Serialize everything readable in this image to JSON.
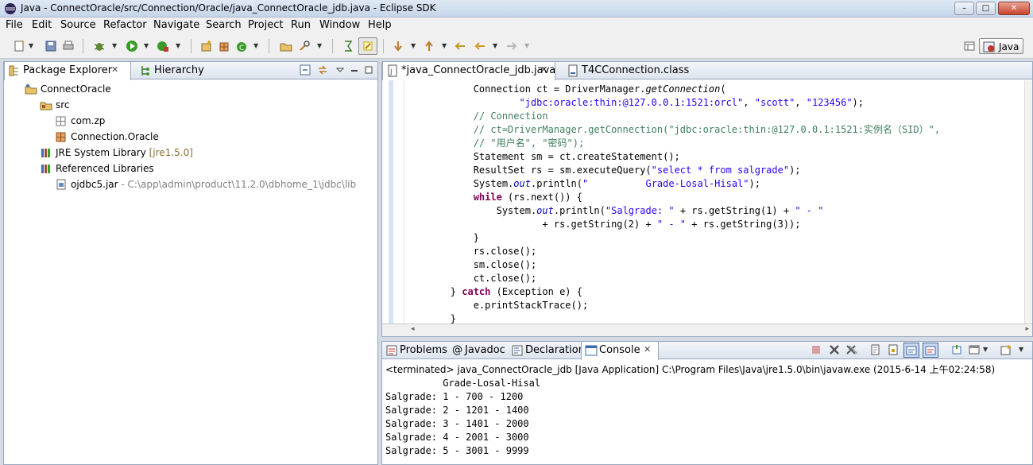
{
  "window": {
    "title": "Java - ConnectOracle/src/Connection/Oracle/java_ConnectOracle_jdb.java - Eclipse SDK",
    "min_glyph": "–",
    "max_glyph": "□",
    "close_glyph": "✕"
  },
  "menu": [
    "File",
    "Edit",
    "Source",
    "Refactor",
    "Navigate",
    "Search",
    "Project",
    "Run",
    "Window",
    "Help"
  ],
  "toolbar": {
    "perspective_label": "Java"
  },
  "package_explorer": {
    "tabs": [
      {
        "label": "Package Explorer",
        "close": "✕"
      },
      {
        "label": "Hierarchy"
      }
    ],
    "tree": [
      {
        "label": "ConnectOracle",
        "suffix": "",
        "decor": "",
        "icon": "java-project-icon"
      },
      {
        "label": "src",
        "suffix": "",
        "decor": "",
        "icon": "source-folder-icon"
      },
      {
        "label": "com.zp",
        "suffix": "",
        "decor": "",
        "icon": "package-empty-icon"
      },
      {
        "label": "Connection.Oracle",
        "suffix": "",
        "decor": "",
        "icon": "package-icon"
      },
      {
        "label": "JRE System Library",
        "suffix": "[jre1.5.0]",
        "decor": "",
        "icon": "library-icon"
      },
      {
        "label": "Referenced Libraries",
        "suffix": "",
        "decor": "",
        "icon": "library-icon"
      },
      {
        "label": "ojdbc5.jar",
        "suffix": "",
        "decor": " - C:\\app\\admin\\product\\11.2.0\\dbhome_1\\jdbc\\lib",
        "icon": "jar-icon"
      }
    ]
  },
  "editor": {
    "tabs": [
      {
        "label": "*java_ConnectOracle_jdb.java",
        "close": "✕"
      },
      {
        "label": "T4CConnection.class"
      }
    ],
    "lines": [
      [
        [
          "",
          "            Connection ct = DriverManager."
        ],
        [
          "sm",
          "getConnection"
        ],
        [
          "",
          "("
        ]
      ],
      [
        [
          "",
          "                    "
        ],
        [
          "str",
          "\"jdbc:oracle:thin:@127.0.0.1:1521:orcl\""
        ],
        [
          "",
          ", "
        ],
        [
          "str",
          "\"scott\""
        ],
        [
          "",
          ", "
        ],
        [
          "str",
          "\"123456\""
        ],
        [
          "",
          ");"
        ]
      ],
      [
        [
          "cm",
          "            // Connection"
        ]
      ],
      [
        [
          "cm",
          "            // ct=DriverManager.getConnection(\"jdbc:oracle:thin:@127.0.0.1:1521:实例名（SID）\","
        ]
      ],
      [
        [
          "cm",
          "            // \"用户名\", \"密码\");"
        ]
      ],
      [
        [
          "",
          "            Statement sm = ct.createStatement();"
        ]
      ],
      [
        [
          "",
          "            ResultSet rs = sm.executeQuery("
        ],
        [
          "str",
          "\"select * from salgrade\""
        ],
        [
          "",
          ");"
        ]
      ],
      [
        [
          "",
          "            System."
        ],
        [
          "fld",
          "out"
        ],
        [
          "",
          ".println("
        ],
        [
          "str",
          "\"          Grade-Losal-Hisal\""
        ],
        [
          "",
          ");"
        ]
      ],
      [
        [
          "kw",
          "            while"
        ],
        [
          "",
          " (rs.next()) {"
        ]
      ],
      [
        [
          "",
          "                System."
        ],
        [
          "fld",
          "out"
        ],
        [
          "",
          ".println("
        ],
        [
          "str",
          "\"Salgrade: \""
        ],
        [
          "",
          " + rs.getString(1) + "
        ],
        [
          "str",
          "\" - \""
        ]
      ],
      [
        [
          "",
          "                        + rs.getString(2) + "
        ],
        [
          "str",
          "\" - \""
        ],
        [
          "",
          " + rs.getString(3));"
        ]
      ],
      [
        [
          "",
          "            }"
        ]
      ],
      [
        [
          "",
          "            rs.close();"
        ]
      ],
      [
        [
          "",
          "            sm.close();"
        ]
      ],
      [
        [
          "",
          "            ct.close();"
        ]
      ],
      [
        [
          "",
          "        } "
        ],
        [
          "kw",
          "catch"
        ],
        [
          "",
          " (Exception e) {"
        ]
      ],
      [
        [
          "",
          "            e.printStackTrace();"
        ]
      ],
      [
        [
          "",
          "        }"
        ]
      ]
    ]
  },
  "bottom_panel": {
    "tabs": [
      {
        "label": "Problems"
      },
      {
        "label": "Javadoc",
        "prefix": "@"
      },
      {
        "label": "Declaration"
      },
      {
        "label": "Console",
        "close": "✕"
      }
    ],
    "status": "<terminated> java_ConnectOracle_jdb [Java Application] C:\\Program Files\\Java\\jre1.5.0\\bin\\javaw.exe (2015-6-14 上午02:24:58)",
    "output": [
      "          Grade-Losal-Hisal",
      "Salgrade: 1 - 700 - 1200",
      "Salgrade: 2 - 1201 - 1400",
      "Salgrade: 3 - 1401 - 2000",
      "Salgrade: 4 - 2001 - 3000",
      "Salgrade: 5 - 3001 - 9999"
    ]
  },
  "colors": {
    "keyword": "#7f0055",
    "string": "#2a00ff",
    "comment": "#3f7f5f",
    "field": "#0000c0",
    "library_suffix": "#8a6d2e"
  }
}
